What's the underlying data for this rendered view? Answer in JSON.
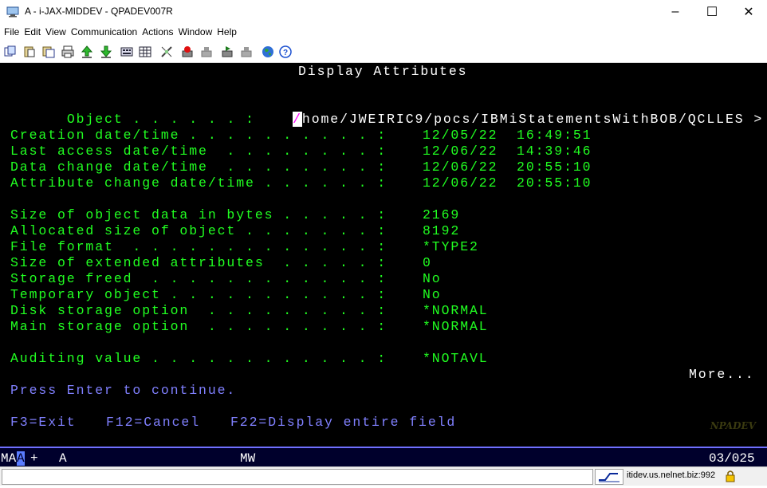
{
  "window": {
    "title": "A - i-JAX-MIDDEV - QPADEV007R",
    "minimize": "–",
    "maximize": "☐",
    "close": "✕"
  },
  "menu": {
    "items": [
      "File",
      "Edit",
      "View",
      "Communication",
      "Actions",
      "Window",
      "Help"
    ]
  },
  "toolbar": {
    "icons": [
      "copy-icon",
      "paste-icon",
      "copy-append-icon",
      "print-screen-icon",
      "send-file-icon",
      "receive-file-icon",
      "keypad-icon",
      "macro-icon",
      "graphics-icon",
      "record-macro-icon",
      "stop-macro-icon",
      "play-macro-icon",
      "pause-macro-icon",
      "web-icon",
      "help-icon"
    ]
  },
  "screen": {
    "title": "Display Attributes",
    "object_label": "Object . . . . . . :",
    "object_cursor": "/",
    "object_value": "home/JWEIRIC9/pocs/IBMiStatementsWithBOB/QCLLES >",
    "rows1": [
      {
        "label": "Creation date/time . . . . . . . . . . :",
        "value": "12/05/22  16:49:51"
      },
      {
        "label": "Last access date/time  . . . . . . . . :",
        "value": "12/06/22  14:39:46"
      },
      {
        "label": "Data change date/time  . . . . . . . . :",
        "value": "12/06/22  20:55:10"
      },
      {
        "label": "Attribute change date/time . . . . . . :",
        "value": "12/06/22  20:55:10"
      }
    ],
    "rows2": [
      {
        "label": "Size of object data in bytes . . . . . :",
        "value": "2169"
      },
      {
        "label": "Allocated size of object . . . . . . . :",
        "value": "8192"
      },
      {
        "label": "File format  . . . . . . . . . . . . . :",
        "value": "*TYPE2"
      },
      {
        "label": "Size of extended attributes  . . . . . :",
        "value": "0"
      },
      {
        "label": "Storage freed  . . . . . . . . . . . . :",
        "value": "No"
      },
      {
        "label": "Temporary object . . . . . . . . . . . :",
        "value": "No"
      },
      {
        "label": "Disk storage option  . . . . . . . . . :",
        "value": "*NORMAL"
      },
      {
        "label": "Main storage option  . . . . . . . . . :",
        "value": "*NORMAL"
      }
    ],
    "rows3": [
      {
        "label": "Auditing value . . . . . . . . . . . . :",
        "value": "*NOTAVL"
      }
    ],
    "more": "More...",
    "press_enter": "Press Enter to continue.",
    "fkeys": [
      "F3=Exit",
      "F12=Cancel",
      "F22=Display entire field"
    ],
    "watermark": "NPADEV"
  },
  "oia": {
    "ma": "MA",
    "indicator": "A",
    "plus": "+",
    "session": "A",
    "mw": "MW",
    "position": "03/025"
  },
  "statusbar": {
    "host": "itidev.us.nelnet.biz:992"
  }
}
